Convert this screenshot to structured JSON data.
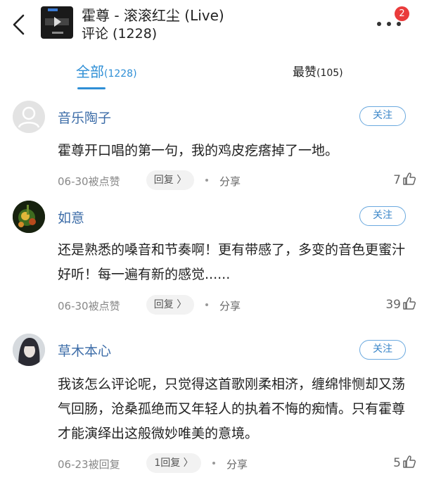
{
  "header": {
    "song_title": "霍尊 - 滚滚红尘 (Live)",
    "subtitle": "评论 (1228)",
    "badge": "2"
  },
  "tabs": {
    "all_label": "全部",
    "all_count": "(1228)",
    "like_label": "最赞",
    "like_count": "(105)"
  },
  "comments": [
    {
      "user": "音乐陶子",
      "follow": "关注",
      "text": "霍尊开口唱的第一句，我的鸡皮疙瘩掉了一地。",
      "date": "06-30被点赞",
      "reply": "回复 〉",
      "share": "分享",
      "likes": "7"
    },
    {
      "user": "如意",
      "follow": "关注",
      "text": "还是熟悉的嗓音和节奏啊！更有带感了，多变的音色更蜜汁好听！每一遍有新的感觉......",
      "date": "06-30被点赞",
      "reply": "回复 〉",
      "share": "分享",
      "likes": "39"
    },
    {
      "user": "草木本心",
      "follow": "关注",
      "text": "我该怎么评论呢，只觉得这首歌刚柔相济，缠绵悱恻却又荡气回肠，沧桑孤绝而又年轻人的执着不悔的痴情。只有霍尊才能演绎出这般微妙唯美的意境。",
      "date": "06-23被回复",
      "reply": "1回复 〉",
      "share": "分享",
      "likes": "5"
    }
  ]
}
